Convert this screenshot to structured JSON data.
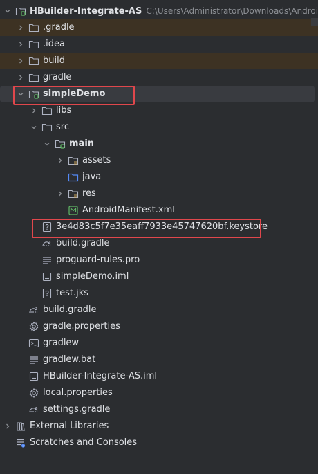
{
  "project": {
    "name": "HBuilder-Integrate-AS",
    "path": "C:\\Users\\Administrator\\Downloads\\Android-"
  },
  "rows": [
    {
      "label": ".gradle",
      "icon": "folder-icon",
      "chevron": "right",
      "depth": 1,
      "excluded": true
    },
    {
      "label": ".idea",
      "icon": "folder-icon",
      "chevron": "right",
      "depth": 1
    },
    {
      "label": "build",
      "icon": "folder-icon",
      "chevron": "right",
      "depth": 1,
      "excluded": true
    },
    {
      "label": "gradle",
      "icon": "folder-icon",
      "chevron": "right",
      "depth": 1
    },
    {
      "label": "simpleDemo",
      "icon": "module-folder-icon",
      "chevron": "down",
      "depth": 1,
      "bold": true,
      "selected": true
    },
    {
      "label": "libs",
      "icon": "folder-icon",
      "chevron": "right",
      "depth": 2
    },
    {
      "label": "src",
      "icon": "folder-icon",
      "chevron": "down",
      "depth": 2
    },
    {
      "label": "main",
      "icon": "source-root-folder-icon",
      "chevron": "down",
      "depth": 3,
      "bold": true
    },
    {
      "label": "assets",
      "icon": "resource-folder-icon",
      "chevron": "right",
      "depth": 4
    },
    {
      "label": "java",
      "icon": "source-folder-icon",
      "chevron": "none",
      "depth": 4
    },
    {
      "label": "res",
      "icon": "resource-folder-icon",
      "chevron": "right",
      "depth": 4
    },
    {
      "label": "AndroidManifest.xml",
      "icon": "manifest-icon",
      "chevron": "none",
      "depth": 4
    },
    {
      "label": "3e4d83c5f7e35eaff7933e45747620bf.keystore",
      "icon": "unknown-file-icon",
      "chevron": "none",
      "depth": 2
    },
    {
      "label": "build.gradle",
      "icon": "gradle-icon",
      "chevron": "none",
      "depth": 2
    },
    {
      "label": "proguard-rules.pro",
      "icon": "text-file-icon",
      "chevron": "none",
      "depth": 2
    },
    {
      "label": "simpleDemo.iml",
      "icon": "iml-file-icon",
      "chevron": "none",
      "depth": 2
    },
    {
      "label": "test.jks",
      "icon": "unknown-file-icon",
      "chevron": "none",
      "depth": 2
    },
    {
      "label": "build.gradle",
      "icon": "gradle-icon",
      "chevron": "none",
      "depth": 1
    },
    {
      "label": "gradle.properties",
      "icon": "settings-icon",
      "chevron": "none",
      "depth": 1
    },
    {
      "label": "gradlew",
      "icon": "terminal-icon",
      "chevron": "none",
      "depth": 1
    },
    {
      "label": "gradlew.bat",
      "icon": "text-file-icon",
      "chevron": "none",
      "depth": 1
    },
    {
      "label": "HBuilder-Integrate-AS.iml",
      "icon": "iml-file-icon",
      "chevron": "none",
      "depth": 1
    },
    {
      "label": "local.properties",
      "icon": "settings-icon",
      "chevron": "none",
      "depth": 1
    },
    {
      "label": "settings.gradle",
      "icon": "gradle-icon",
      "chevron": "none",
      "depth": 1
    },
    {
      "label": "External Libraries",
      "icon": "library-icon",
      "chevron": "right",
      "depth": 0
    },
    {
      "label": "Scratches and Consoles",
      "icon": "scratches-icon",
      "chevron": "none",
      "depth": 0
    }
  ],
  "colors": {
    "background": "#2b2d30",
    "highlight_box": "#e0474c",
    "excluded_row": "#3d3223",
    "selected_row": "#393b40",
    "folder": "#aeb3c2",
    "source_folder": "#548af7",
    "module_dot": "#5fb865",
    "manifest": "#5fb865",
    "text": "#dfe1e5",
    "path_text": "#8c8f94"
  }
}
